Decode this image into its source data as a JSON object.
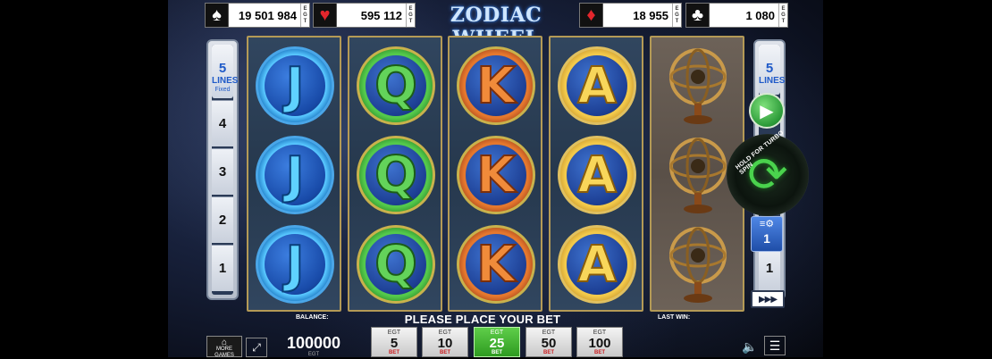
{
  "game": {
    "title": "ZODIAC WHEEL",
    "provider": "EGT"
  },
  "jackpots": [
    {
      "suit": "spades",
      "glyph": "♠",
      "value": "19 501 984"
    },
    {
      "suit": "hearts",
      "glyph": "♥",
      "value": "595 112"
    },
    {
      "suit": "diamonds",
      "glyph": "♦",
      "value": "18 955"
    },
    {
      "suit": "clubs",
      "glyph": "♣",
      "value": "1 080"
    }
  ],
  "lines": {
    "count": "5",
    "label": "LINES",
    "fixed": "Fixed",
    "numbers": [
      "4",
      "3",
      "2",
      "1"
    ]
  },
  "right_lines": {
    "count": "5",
    "label": "LINES",
    "numbers": [
      "1"
    ]
  },
  "reels": [
    {
      "symbol": "J",
      "rows": [
        "J",
        "J",
        "J"
      ]
    },
    {
      "symbol": "Q",
      "rows": [
        "Q",
        "Q",
        "Q"
      ]
    },
    {
      "symbol": "K",
      "rows": [
        "K",
        "K",
        "K"
      ]
    },
    {
      "symbol": "A",
      "rows": [
        "A",
        "A",
        "A"
      ]
    },
    {
      "symbol": "orrery",
      "rows": [
        "orrery",
        "orrery",
        "orrery"
      ]
    }
  ],
  "controls": {
    "turbo_hint": "HOLD FOR TURBO SPIN",
    "bet_multiplier": "1",
    "more_games": "MORE GAMES"
  },
  "bottom": {
    "balance_label": "BALANCE:",
    "balance_value": "100000",
    "balance_egt": "EGT",
    "message": "PLEASE PLACE YOUR BET",
    "last_win_label": "LAST WIN:"
  },
  "bets": [
    {
      "value": "5",
      "label": "BET",
      "brand": "EGT",
      "active": false
    },
    {
      "value": "10",
      "label": "BET",
      "brand": "EGT",
      "active": false
    },
    {
      "value": "25",
      "label": "BET",
      "brand": "EGT",
      "active": true
    },
    {
      "value": "50",
      "label": "BET",
      "brand": "EGT",
      "active": false
    },
    {
      "value": "100",
      "label": "BET",
      "brand": "EGT",
      "active": false
    }
  ],
  "colors": {
    "active_bet": "#3fb12f",
    "panel_blue": "#1f5ac8",
    "frame_gold": "#b49a56"
  }
}
